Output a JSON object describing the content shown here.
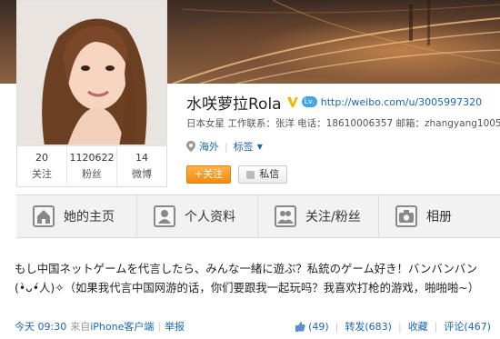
{
  "profile": {
    "name": "水咲萝拉Rola",
    "verified_badge": "V",
    "level_badge": "Lv.",
    "url": "http://weibo.com/u/3005997320",
    "description": "日本女星 工作联系：张洋 电话：18610006357 邮箱：zhangyang1005",
    "location": "海外",
    "tags_label": "标签",
    "stats": [
      {
        "value": "20",
        "label": "关注"
      },
      {
        "value": "1120622",
        "label": "粉丝"
      },
      {
        "value": "14",
        "label": "微博"
      }
    ],
    "follow_button": "+关注",
    "message_button": "私信"
  },
  "tabs": [
    {
      "label": "她的主页",
      "icon": "home-icon"
    },
    {
      "label": "个人资料",
      "icon": "profile-icon"
    },
    {
      "label": "关注/粉丝",
      "icon": "users-icon"
    },
    {
      "label": "相册",
      "icon": "camera-icon"
    }
  ],
  "post": {
    "text": "もし中国ネットゲームを代言したら、みんな一緒に遊ぶ？私銃のゲーム好き！バンバンバン(•̀ᴗ•́人)✧（如果我代言中国网游的话，你们要跟我一起玩吗？我喜欢打枪的游戏，啪啪啪~）",
    "time": "今天 09:30",
    "source_prefix": "来自",
    "source": "iPhone客户端",
    "report": "举报",
    "likes": "(49)",
    "repost": "转发(683)",
    "favorite": "收藏",
    "comment": "评论(467)"
  },
  "colors": {
    "link": "#1a66b3",
    "follow_orange": "#f08a10",
    "badge_blue": "#3fa7e0",
    "verified_gold": "#f2b500"
  }
}
